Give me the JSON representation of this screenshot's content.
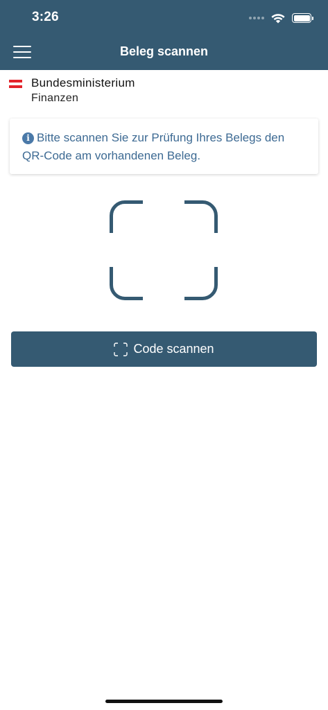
{
  "status_bar": {
    "time": "3:26"
  },
  "header": {
    "title": "Beleg scannen",
    "menu_icon": "hamburger-menu-icon"
  },
  "logo": {
    "line1": "Bundesministerium",
    "line2": "Finanzen",
    "flag_colors": [
      "#e3242b",
      "#ffffff",
      "#e3242b"
    ]
  },
  "info": {
    "icon": "info-icon",
    "icon_glyph": "i",
    "text": "Bitte scannen Sie zur Prüfung Ihres Belegs den QR-Code am vorhandenen Beleg."
  },
  "scan_button": {
    "label": "Code scannen",
    "icon": "scan-frame-icon"
  },
  "colors": {
    "primary": "#355a72",
    "info_text": "#3d6a93",
    "flag_red": "#e3242b"
  }
}
